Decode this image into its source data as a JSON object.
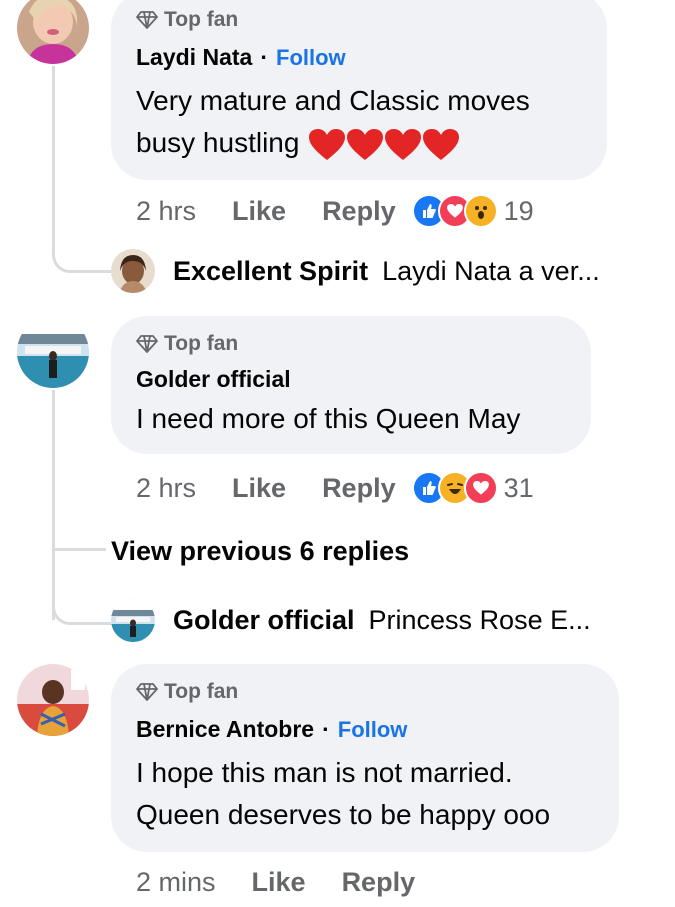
{
  "comments": [
    {
      "badge": "Top fan",
      "author": "Laydi Nata",
      "separator": "·",
      "follow": "Follow",
      "line1": "Very mature and Classic moves",
      "line2": "busy hustling",
      "time": "2 hrs",
      "like": "Like",
      "reply": "Reply",
      "reaction_count": "19",
      "reactions": [
        "like-icon",
        "love-icon",
        "wow-icon"
      ]
    },
    {
      "badge": "Top fan",
      "author": "Golder official",
      "line1": "I need more of this Queen May",
      "time": "2 hrs",
      "like": "Like",
      "reply": "Reply",
      "reaction_count": "31",
      "reactions": [
        "like-icon",
        "haha-icon",
        "love-icon"
      ]
    },
    {
      "badge": "Top fan",
      "author": "Bernice Antobre",
      "separator": "·",
      "follow": "Follow",
      "line1": "I hope this man is not married.",
      "line2": "Queen deserves to be happy ooo",
      "time": "2 mins",
      "like": "Like",
      "reply": "Reply"
    }
  ],
  "replies": [
    {
      "author": "Excellent Spirit",
      "preview": "Laydi Nata a ver..."
    },
    {
      "author": "Golder official",
      "preview": "Princess Rose E..."
    }
  ],
  "view_previous": "View previous 6 replies",
  "colors": {
    "bubble": "#f0f2f5",
    "secondary_text": "#65676b",
    "follow_blue": "#1b74e4",
    "like_blue": "#1877f2",
    "love_red": "#f33e58",
    "wow_yellow": "#f7b125"
  }
}
